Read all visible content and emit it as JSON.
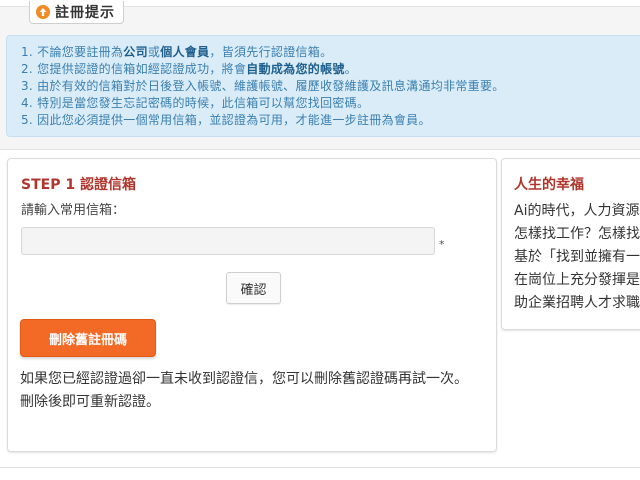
{
  "notice": {
    "tab_title": "註冊提示",
    "icon": "arrow-up-circle-icon",
    "accent": "#f08a24",
    "items": [
      {
        "parts": [
          {
            "t": "1. 不論您要註冊為",
            "b": false
          },
          {
            "t": "公司",
            "b": true
          },
          {
            "t": "或",
            "b": false
          },
          {
            "t": "個人會員",
            "b": true
          },
          {
            "t": "，皆須先行認證信箱。",
            "b": false
          }
        ]
      },
      {
        "parts": [
          {
            "t": "2. 您提供認證的信箱如經認證成功，將會",
            "b": false
          },
          {
            "t": "自動成為您的帳號",
            "b": true
          },
          {
            "t": "。",
            "b": false
          }
        ]
      },
      {
        "parts": [
          {
            "t": "3. 由於有效的信箱對於日後登入帳號、維護帳號、履歷收發維護及訊息溝通均非常重要。",
            "b": false
          }
        ]
      },
      {
        "parts": [
          {
            "t": "4. 特別是當您發生忘記密碼的時候，此信箱可以幫您找回密碼。",
            "b": false
          }
        ]
      },
      {
        "parts": [
          {
            "t": "5. 因此您必須提供一個常用信箱，並認證為可用，才能進一步註冊為會員。",
            "b": false
          }
        ]
      }
    ]
  },
  "main": {
    "step_title": "STEP 1 認證信箱",
    "field_label": "請輸入常用信箱：",
    "email_value": "",
    "email_placeholder": "",
    "required_mark": "*",
    "confirm_label": "確認",
    "delete_label": "刪除舊註冊碼",
    "help_text": "如果您已經認證過卻一直未收到認證信，您可以刪除舊認證碼再試一次。刪除後即可重新認證。"
  },
  "side": {
    "title": "人生的幸福",
    "lines": [
      "Ai的時代，人力資源",
      "怎樣找工作？怎樣找",
      "基於「找到並擁有一",
      "在崗位上充分發揮是",
      "助企業招聘人才求職"
    ]
  },
  "colors": {
    "title_red": "#b0352c",
    "notice_text": "#3b7fb0",
    "notice_bg": "#d9ecf7",
    "delete_button": "#f26a25"
  }
}
